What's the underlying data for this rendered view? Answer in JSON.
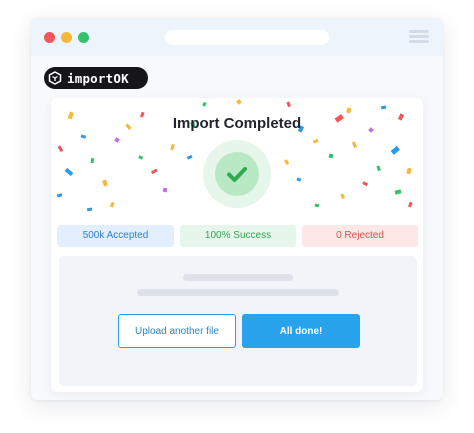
{
  "app": {
    "brand_name": "importOK",
    "logo_icon": "hexagon-cube-icon"
  },
  "window": {
    "controls": [
      "close-dot",
      "minimize-dot",
      "maximize-dot"
    ],
    "menu_icon": "hamburger-menu-icon"
  },
  "result": {
    "title": "Import Completed",
    "status_icon": "checkmark-icon",
    "stats": {
      "accepted": "500k Accepted",
      "success": "100% Success",
      "rejected": "0 Rejected"
    }
  },
  "actions": {
    "upload_label": "Upload another file",
    "done_label": "All done!"
  },
  "colors": {
    "accent": "#28a2ea",
    "success": "#35a354",
    "error": "#e04e4e",
    "info": "#2f7fd6"
  }
}
